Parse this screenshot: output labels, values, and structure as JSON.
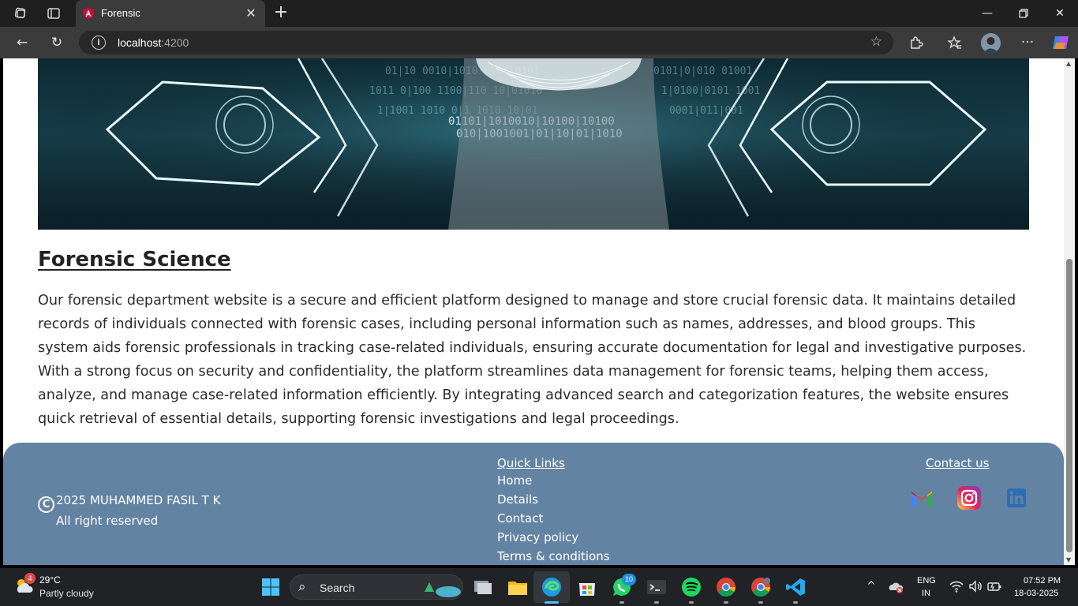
{
  "browser": {
    "tab_title": "Forensic",
    "url_host": "localhost",
    "url_port": ":4200",
    "icons": {
      "workspaces": "workspaces-icon",
      "tab_actions": "tab-actions-icon",
      "back": "back-arrow-icon",
      "refresh": "refresh-icon",
      "info": "site-info-icon",
      "favorite": "star-icon",
      "extensions": "extensions-icon",
      "favorites": "favorites-icon",
      "profile": "profile-avatar",
      "more": "more-icon",
      "copilot": "copilot-icon"
    }
  },
  "article": {
    "title": "Forensic Science",
    "paragraph1": "Our forensic department website is a secure and efficient platform designed to manage and store crucial forensic data. It maintains detailed records of individuals connected with forensic cases, including personal information such as names, addresses, and blood groups. This system aids forensic professionals in tracking case-related individuals, ensuring accurate documentation for legal and investigative purposes.",
    "paragraph2": "With a strong focus on security and confidentiality, the platform streamlines data management for forensic teams, helping them access, analyze, and manage case-related information efficiently. By integrating advanced search and categorization features, the website ensures quick retrieval of essential details, supporting forensic investigations and legal proceedings."
  },
  "footer": {
    "copyright_symbol": "C",
    "copyright": "2025 MUHAMMED FASIL T K",
    "rights": "All right reserved",
    "quick_links_heading": "Quick Links",
    "quick_links": [
      "Home",
      "Details",
      "Contact",
      "Privacy policy",
      "Terms & conditions"
    ],
    "contact_heading": "Contact us",
    "social": [
      "gmail-icon",
      "instagram-icon",
      "linkedin-icon"
    ],
    "background_color": "#6383a2"
  },
  "taskbar": {
    "weather_badge": "4",
    "temperature": "29°C",
    "condition": "Partly cloudy",
    "search_label": "Search",
    "whatsapp_badge": "10",
    "lang_line1": "ENG",
    "lang_line2": "IN",
    "time": "07:52 PM",
    "date": "18-03-2025"
  }
}
